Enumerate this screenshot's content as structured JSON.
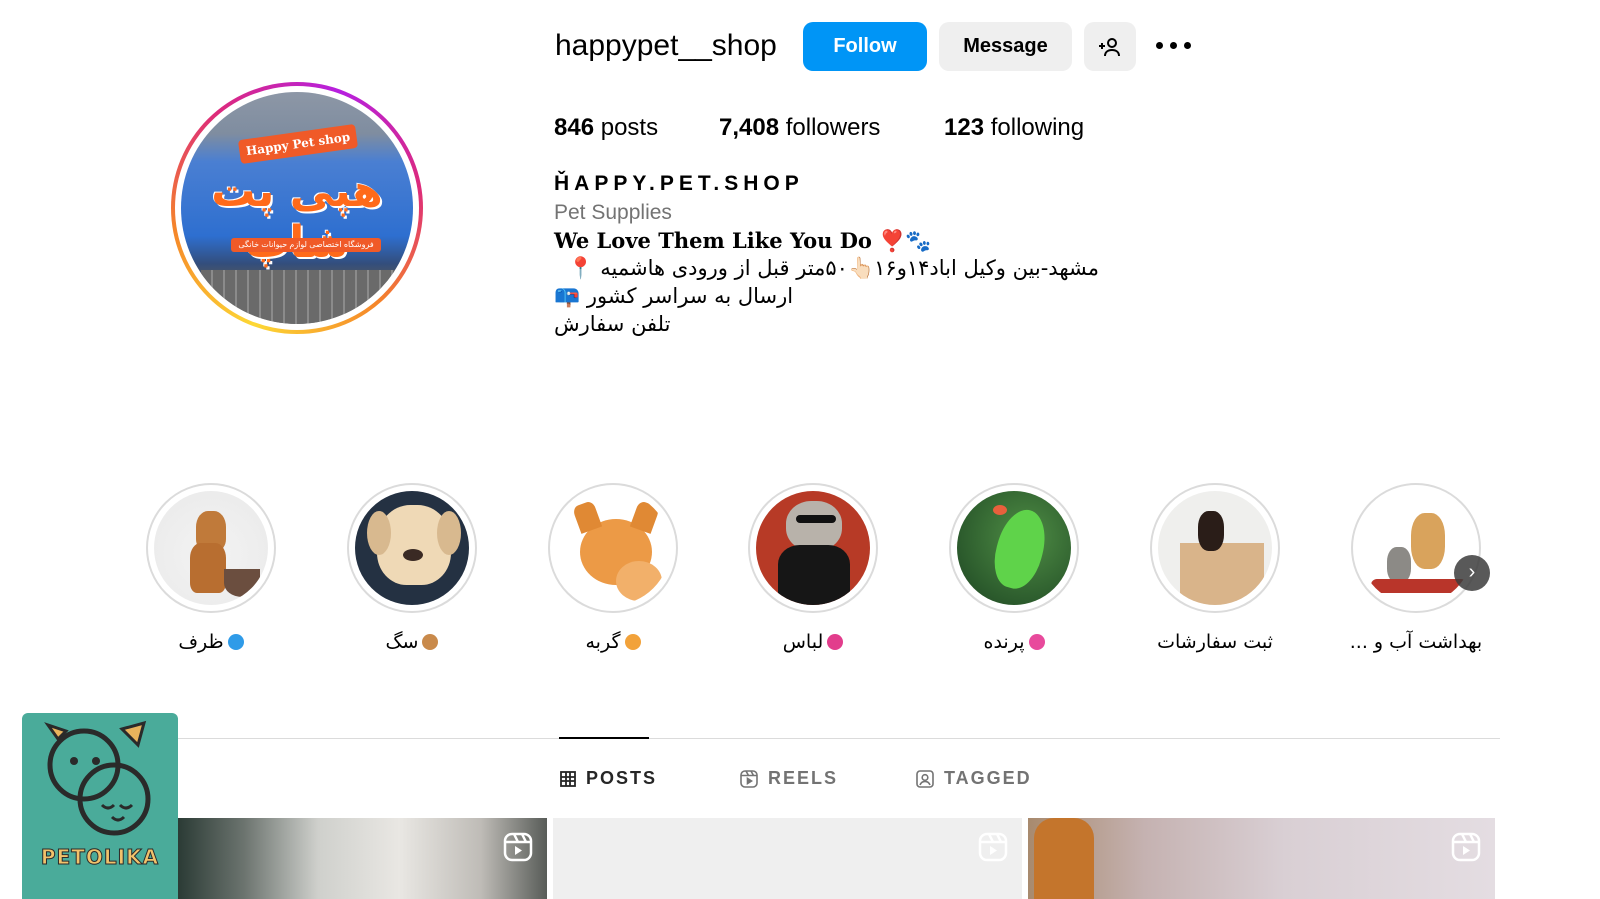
{
  "profile": {
    "username": "happypet__shop",
    "follow_label": "Follow",
    "message_label": "Message",
    "stats": {
      "posts_count": "846",
      "posts_label": "posts",
      "followers_count": "7,408",
      "followers_label": "followers",
      "following_count": "123",
      "following_label": "following"
    },
    "full_name": "ȞAPPY.PET.SHOP",
    "category": "Pet Supplies",
    "slogan": "We Love Them Like You Do ❣️🐾",
    "bio_lines": [
      "مشهد-بین وکیل اباد۱۴و۱۶👆🏻۵۰متر قبل از ورودی هاشمیه 📍",
      "ارسال به سراسر کشور 📪",
      "تلفن سفارش"
    ],
    "avatar_sign": {
      "top_text": "Happy Pet shop",
      "main_text": "هپی پت شاپ",
      "strip_text": "فروشگاه اختصاصی لوازم حیوانات خانگی"
    }
  },
  "highlights": [
    {
      "label": "ظرف",
      "emoji_color": "#2f9be8"
    },
    {
      "label": "سگ",
      "emoji_color": "#c98a4b"
    },
    {
      "label": "گربه",
      "emoji_color": "#f2a23a"
    },
    {
      "label": "لباس",
      "emoji_color": "#e23d8c"
    },
    {
      "label": "پرنده",
      "emoji_color": "#e84a9c"
    },
    {
      "label": "ثبت سفارشات",
      "emoji_color": ""
    },
    {
      "label": "بهداشت آب و ...",
      "emoji_color": ""
    }
  ],
  "tabs": {
    "posts": "POSTS",
    "reels": "REELS",
    "tagged": "TAGGED"
  },
  "watermark": {
    "brand": "PETOLIKA"
  },
  "colors": {
    "accent": "#0095f6",
    "button_gray": "#efefef",
    "muted_text": "#737373",
    "logo_bg": "#4aab9a"
  }
}
